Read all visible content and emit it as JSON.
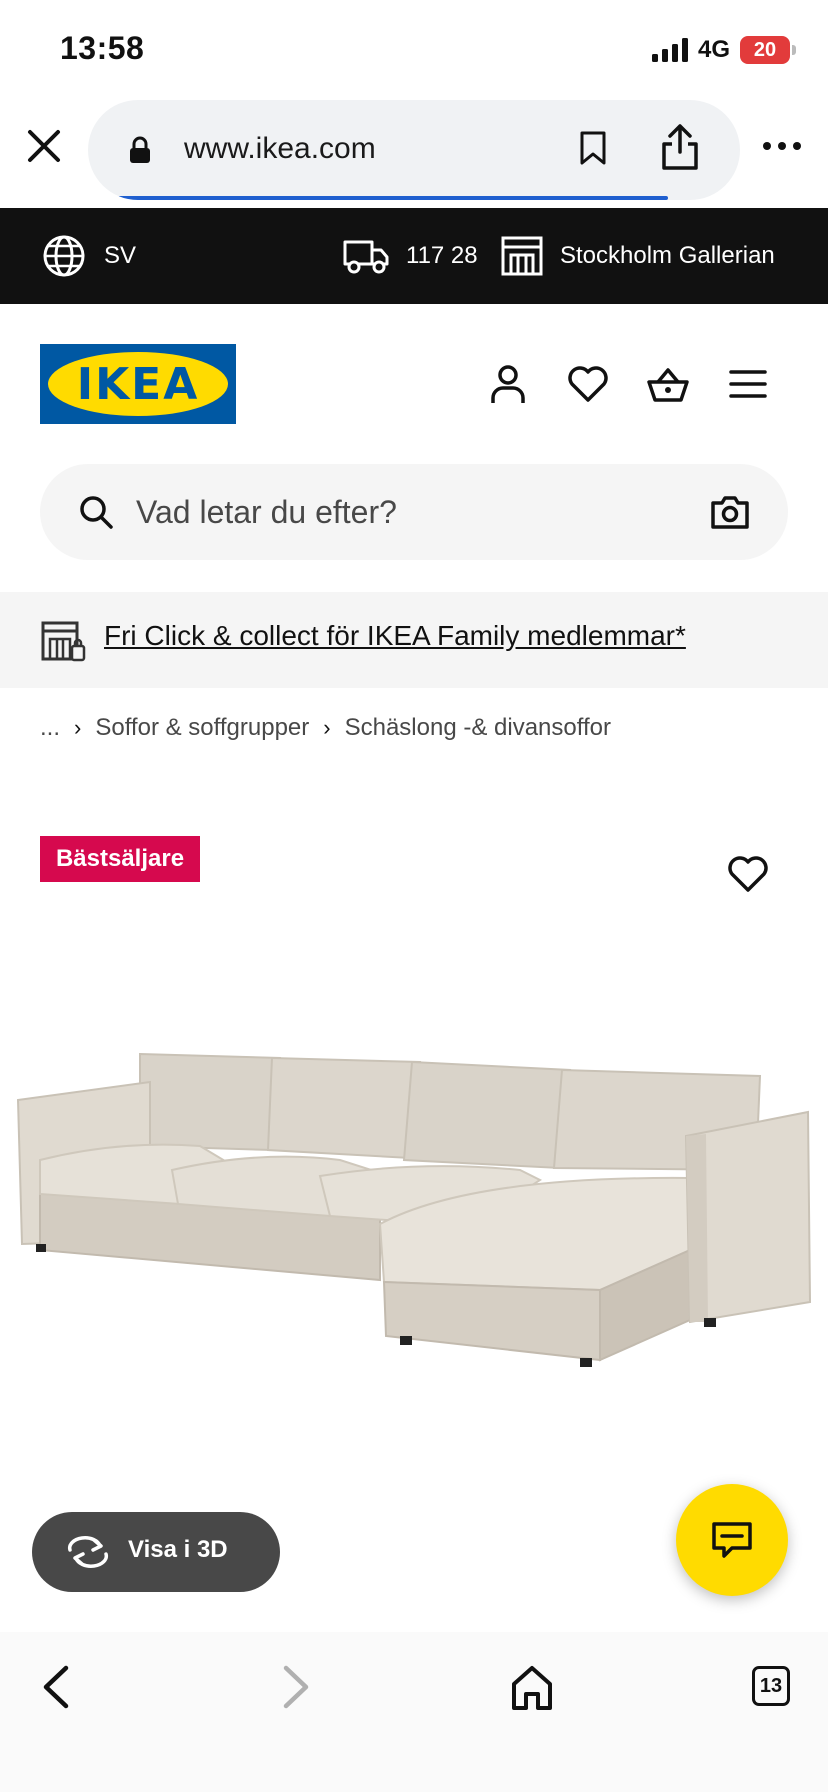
{
  "status_bar": {
    "time": "13:58",
    "network": "4G",
    "battery": "20"
  },
  "browser": {
    "url": "www.ikea.com"
  },
  "top_strip": {
    "language": "SV",
    "postal_code": "117 28",
    "store": "Stockholm Gallerian"
  },
  "header": {
    "logo_text": "IKEA"
  },
  "search": {
    "placeholder": "Vad letar du efter?"
  },
  "promo": {
    "text": "Fri Click & collect för IKEA Family medlemmar*"
  },
  "breadcrumb": {
    "items": [
      "...",
      "Soffor & soffgrupper",
      "Schäslong -& divansoffor"
    ]
  },
  "product": {
    "badge": "Bästsäljare",
    "view_3d_label": "Visa i 3D"
  },
  "bottom_nav": {
    "tabs_count": "13"
  },
  "colors": {
    "brand_blue": "#0058a3",
    "brand_yellow": "#ffdb00",
    "badge_red": "#d6094e",
    "top_strip": "#111111"
  }
}
